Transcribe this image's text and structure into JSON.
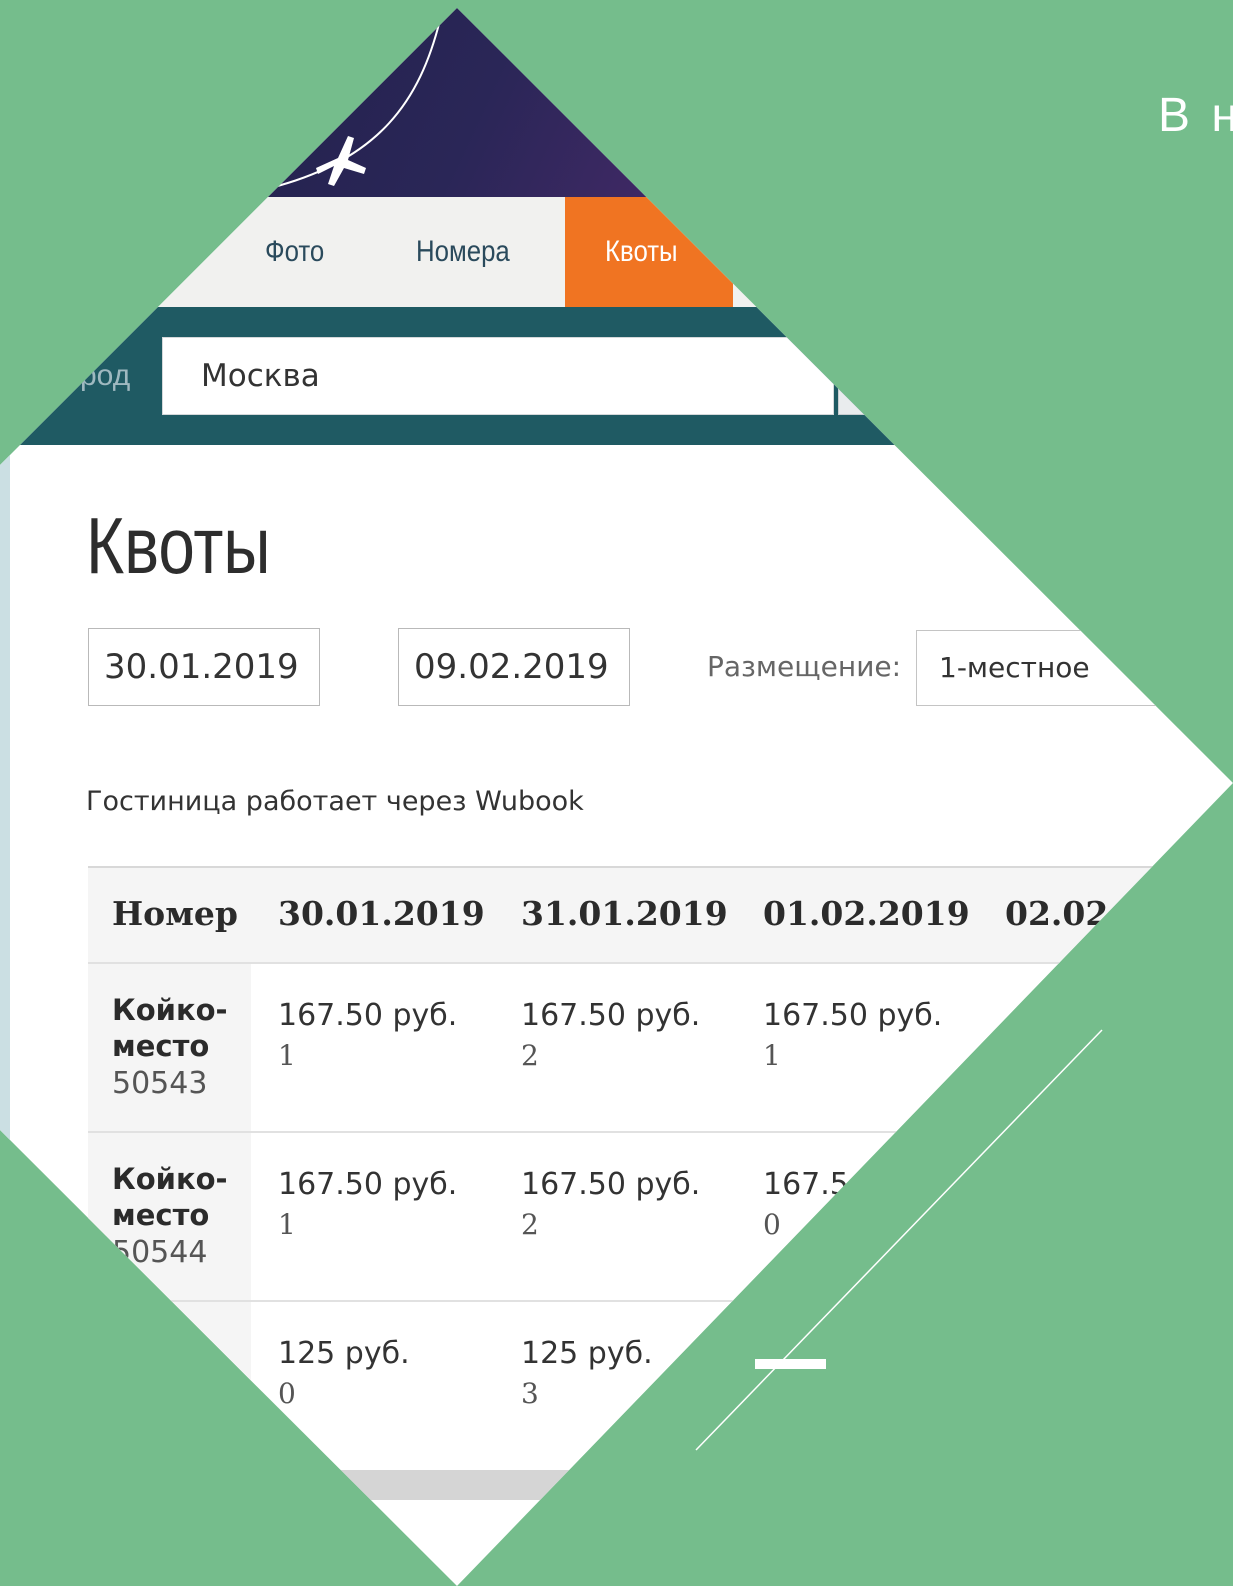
{
  "slide": {
    "heading": "В н"
  },
  "site": {
    "nav": {
      "photo": "Фото",
      "rooms": "Номера",
      "quotas": "Квоты"
    },
    "city": {
      "label": "род",
      "value": "Москва"
    }
  },
  "page": {
    "title": "Квоты",
    "date_from": "30.01.2019",
    "date_to": "09.02.2019",
    "placement_label": "Размещение:",
    "placement_value": "1-местное",
    "hotel_note": "Гостиница работает через Wubook"
  },
  "table": {
    "headers": [
      "Номер",
      "30.01.2019",
      "31.01.2019",
      "01.02.2019",
      "02.02.2"
    ],
    "rows": [
      {
        "room": "Койко-место",
        "id": "50543",
        "cells": [
          {
            "price": "167.50 руб.",
            "qty": "1"
          },
          {
            "price": "167.50 руб.",
            "qty": "2"
          },
          {
            "price": "167.50 руб.",
            "qty": "1"
          }
        ]
      },
      {
        "room": "Койко-место",
        "id": "50544",
        "cells": [
          {
            "price": "167.50 руб.",
            "qty": "1"
          },
          {
            "price": "167.50 руб.",
            "qty": "2"
          },
          {
            "price": "167.5",
            "qty": "0"
          }
        ]
      },
      {
        "room": "",
        "id": "",
        "cells": [
          {
            "price": "125 руб.",
            "qty": "0"
          },
          {
            "price": "125 руб.",
            "qty": "3"
          }
        ]
      }
    ]
  },
  "colors": {
    "slide_green": "#75bd8c",
    "nav_accent": "#f07422",
    "city_bar": "#1f5a63"
  }
}
